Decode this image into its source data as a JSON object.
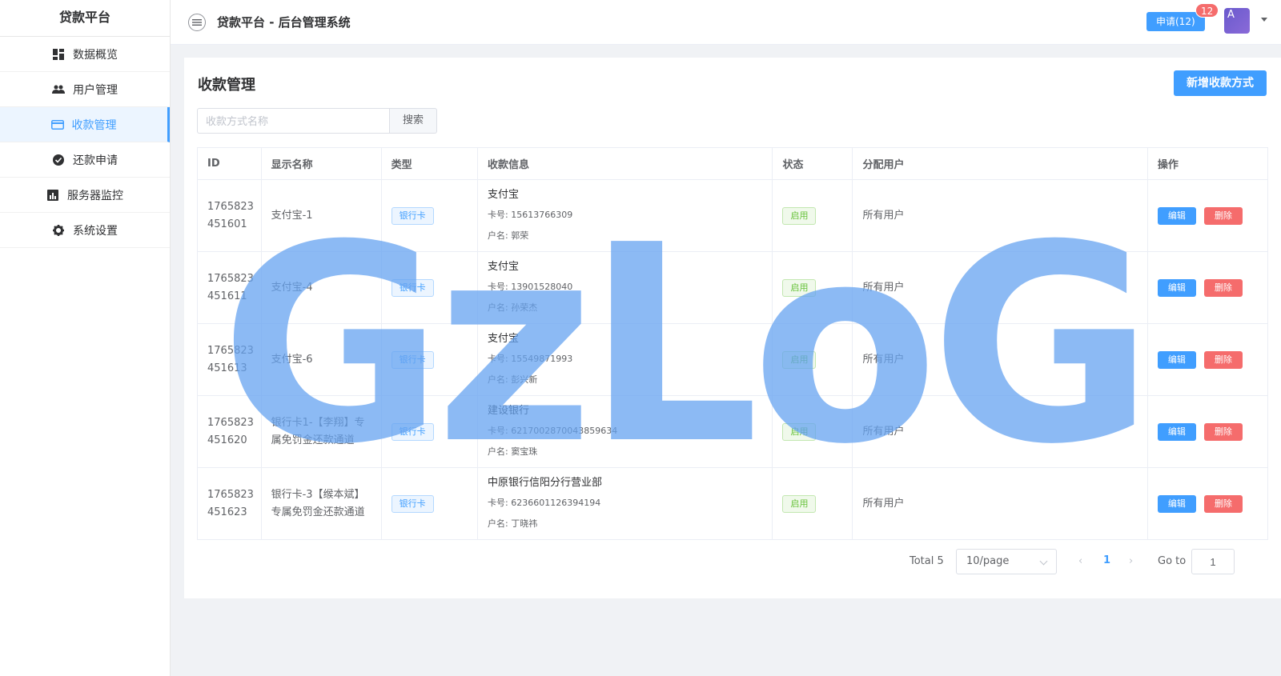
{
  "sidebar": {
    "brand": "贷款平台",
    "items": [
      {
        "label": "数据概览"
      },
      {
        "label": "用户管理"
      },
      {
        "label": "收款管理"
      },
      {
        "label": "还款申请"
      },
      {
        "label": "服务器监控"
      },
      {
        "label": "系统设置"
      }
    ]
  },
  "header": {
    "title": "贷款平台 - 后台管理系统",
    "apply_label": "申请(12)",
    "badge": "12",
    "avatar": "A"
  },
  "main": {
    "title": "收款管理",
    "add_label": "新增收款方式",
    "search_placeholder": "收款方式名称",
    "search_label": "搜索",
    "columns": [
      "ID",
      "显示名称",
      "类型",
      "收款信息",
      "状态",
      "分配用户",
      "操作"
    ],
    "edit_label": "编辑",
    "delete_label": "删除",
    "rows": [
      {
        "id1": "1765823",
        "id2": "451601",
        "name": "支付宝-1",
        "type": "银行卡",
        "info_name": "支付宝",
        "card": "卡号: 15613766309",
        "holder": "户名: 郭荣",
        "status": "启用",
        "users": "所有用户"
      },
      {
        "id1": "1765823",
        "id2": "451611",
        "name": "支付宝-4",
        "type": "银行卡",
        "info_name": "支付宝",
        "card": "卡号: 13901528040",
        "holder": "户名: 孙荣杰",
        "status": "启用",
        "users": "所有用户"
      },
      {
        "id1": "1765823",
        "id2": "451613",
        "name": "支付宝-6",
        "type": "银行卡",
        "info_name": "支付宝",
        "card": "卡号: 15549871993",
        "holder": "户名: 彭兴新",
        "status": "启用",
        "users": "所有用户"
      },
      {
        "id1": "1765823",
        "id2": "451620",
        "name": "银行卡1-【李翔】专属免罚金还款通道",
        "type": "银行卡",
        "info_name": "建设银行",
        "card": "卡号: 6217002870043859634",
        "holder": "户名: 窦宝珠",
        "status": "启用",
        "users": "所有用户"
      },
      {
        "id1": "1765823",
        "id2": "451623",
        "name": "银行卡-3【缑本斌】专属免罚金还款通道",
        "type": "银行卡",
        "info_name": "中原银行信阳分行营业部",
        "card": "卡号: 6236601126394194",
        "holder": "户名: 丁晓祎",
        "status": "启用",
        "users": "所有用户"
      }
    ]
  },
  "pagination": {
    "total": "Total 5",
    "page_size": "10/page",
    "prev": "‹",
    "current": "1",
    "next": "›",
    "goto_label": "Go to",
    "goto_value": "1"
  },
  "watermark": "GzLoG",
  "colors": {
    "primary": "#409eff",
    "danger": "#f56c6c",
    "success": "#67c23a",
    "watermark": "#66a3f0"
  }
}
